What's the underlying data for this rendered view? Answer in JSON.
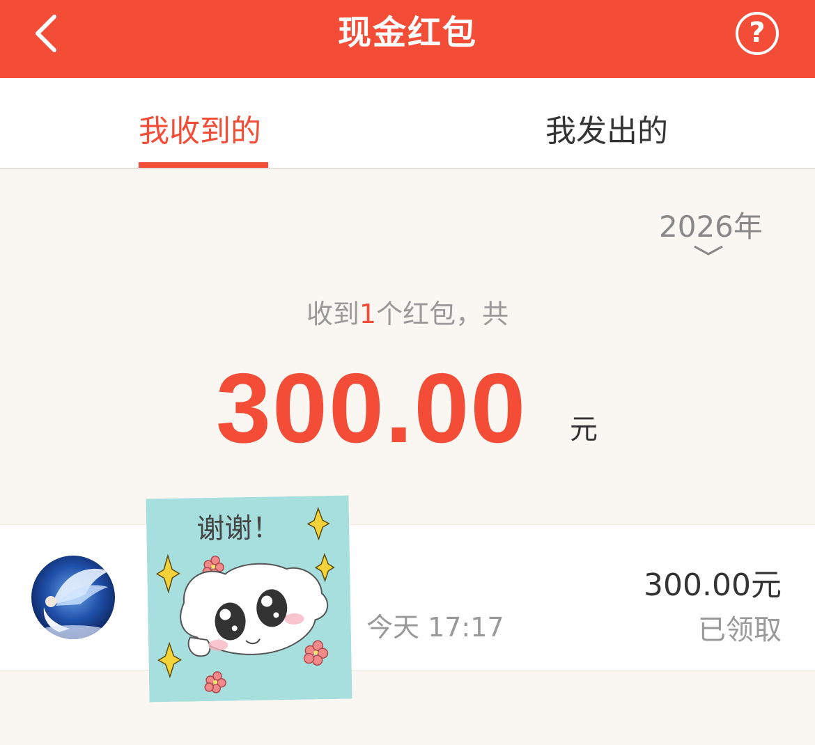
{
  "header": {
    "title": "现金红包",
    "help_label": "?"
  },
  "tabs": [
    {
      "label": "我收到的",
      "active": true
    },
    {
      "label": "我发出的",
      "active": false
    }
  ],
  "year_filter": {
    "label": "2026年"
  },
  "summary": {
    "prefix": "收到",
    "count": "1",
    "suffix": "个红包，共"
  },
  "total": {
    "amount": "300.00",
    "unit": "元"
  },
  "records": [
    {
      "time": "今天 17:17",
      "amount": "300.00元",
      "status": "已领取"
    }
  ],
  "sticker": {
    "text": "谢谢！"
  },
  "colors": {
    "brand": "#f44d37",
    "background": "#faf7f2",
    "text": "#333333",
    "muted": "#999999"
  }
}
